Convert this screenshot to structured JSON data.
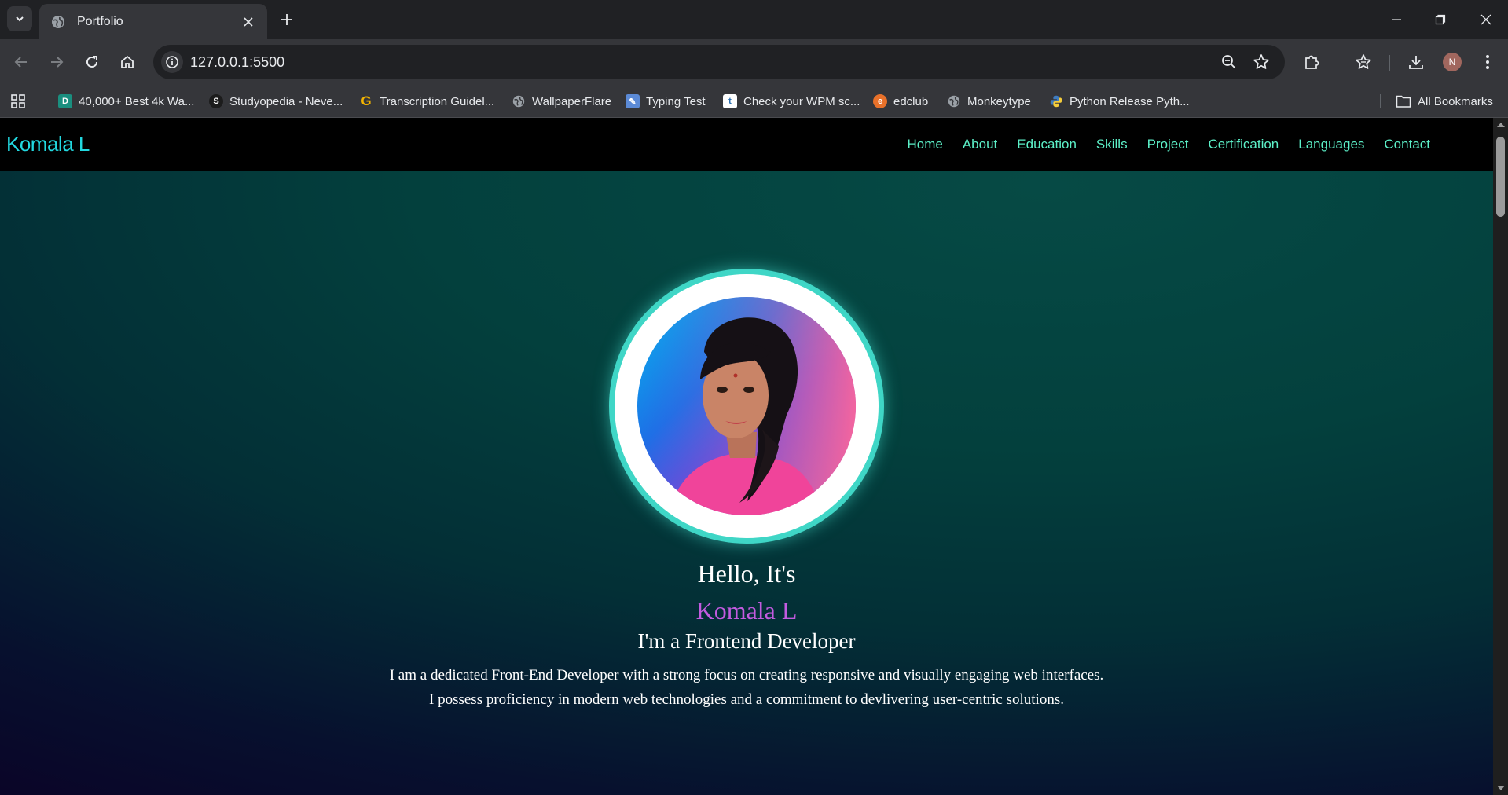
{
  "browser": {
    "tab_title": "Portfolio",
    "url": "127.0.0.1:5500",
    "profile_initial": "N",
    "bookmarks": [
      {
        "label": "40,000+ Best 4k Wa...",
        "icon": "wallhaven-icon"
      },
      {
        "label": "Studyopedia - Neve...",
        "icon": "studyopedia-icon"
      },
      {
        "label": "Transcription Guidel...",
        "icon": "g-logo-icon"
      },
      {
        "label": "WallpaperFlare",
        "icon": "globe-icon"
      },
      {
        "label": "Typing Test",
        "icon": "typing-test-icon"
      },
      {
        "label": "Check your WPM sc...",
        "icon": "t-logo-icon"
      },
      {
        "label": "edclub",
        "icon": "edclub-icon"
      },
      {
        "label": "Monkeytype",
        "icon": "globe-icon"
      },
      {
        "label": "Python Release Pyth...",
        "icon": "python-icon"
      }
    ],
    "all_bookmarks_label": "All Bookmarks"
  },
  "site": {
    "brand": "Komala L",
    "nav": [
      "Home",
      "About",
      "Education",
      "Skills",
      "Project",
      "Certification",
      "Languages",
      "Contact"
    ]
  },
  "hero": {
    "greeting": "Hello, It's",
    "name": "Komala L",
    "role": "I'm a Frontend Developer",
    "desc_line1": "I am a dedicated Front-End Developer with a strong focus on creating responsive and visually engaging web interfaces.",
    "desc_line2": "I possess proficiency in modern web technologies and a commitment to devlivering user-centric solutions."
  },
  "colors": {
    "brand": "#22d8e0",
    "nav_link": "#5cf0c8",
    "name_accent": "#c35be0",
    "ring": "#3fd6c6"
  }
}
